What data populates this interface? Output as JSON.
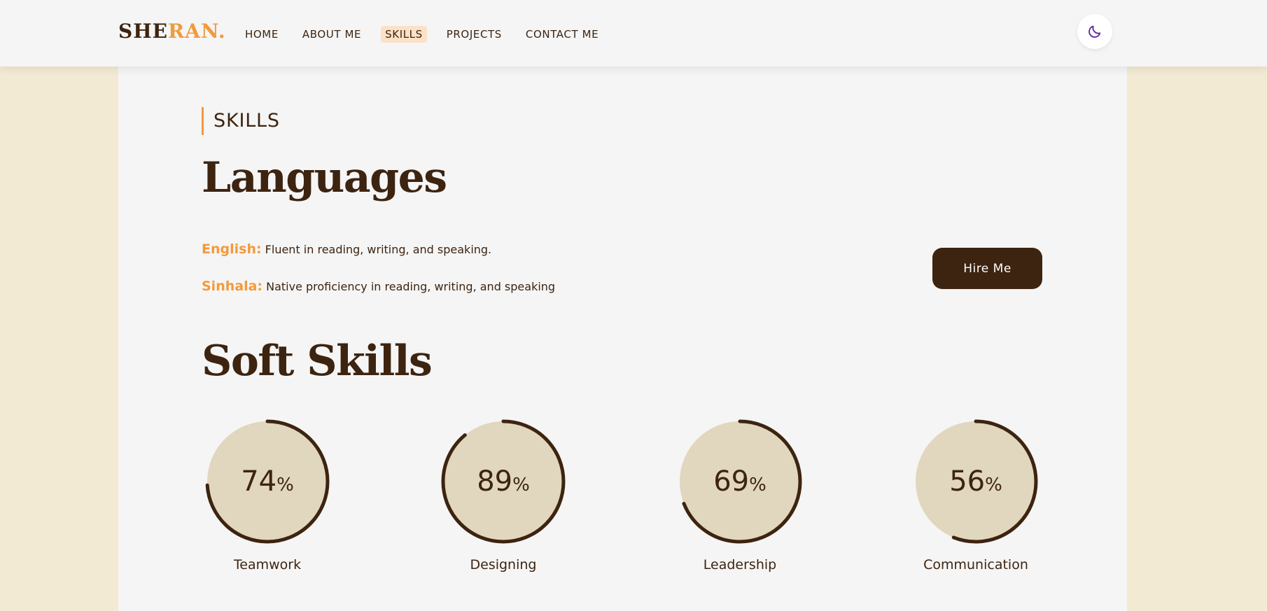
{
  "brand": {
    "logo_part1": "SHE",
    "logo_part2": "RAN."
  },
  "nav": {
    "items": [
      {
        "label": "HOME",
        "active": false
      },
      {
        "label": "ABOUT ME",
        "active": false
      },
      {
        "label": "SKILLS",
        "active": true
      },
      {
        "label": "PROJECTS",
        "active": false
      },
      {
        "label": "CONTACT ME",
        "active": false
      }
    ]
  },
  "theme_toggle": {
    "icon": "moon-icon"
  },
  "section": {
    "tag": "SKILLS"
  },
  "languages": {
    "title": "Languages",
    "items": [
      {
        "name": "English:",
        "desc": "Fluent in reading, writing, and speaking."
      },
      {
        "name": "Sinhala:",
        "desc": "Native proficiency in reading, writing, and speaking"
      }
    ]
  },
  "hire_button": {
    "label": "Hire Me"
  },
  "soft_skills": {
    "title": "Soft Skills",
    "items": [
      {
        "label": "Teamwork",
        "value": "74",
        "percent": 74
      },
      {
        "label": "Designing",
        "value": "89",
        "percent": 89
      },
      {
        "label": "Leadership",
        "value": "69",
        "percent": 69
      },
      {
        "label": "Communication",
        "value": "56",
        "percent": 56
      }
    ],
    "percent_symbol": "%"
  },
  "colors": {
    "page_bg": "#f3ead4",
    "panel_bg": "#f5f5f5",
    "primary_brown": "#3d2410",
    "accent_orange": "#f39a3c",
    "circle_fill": "#e1d6be",
    "nav_active_bg": "#fbe1c6",
    "moon_purple": "#5b2a9e"
  }
}
